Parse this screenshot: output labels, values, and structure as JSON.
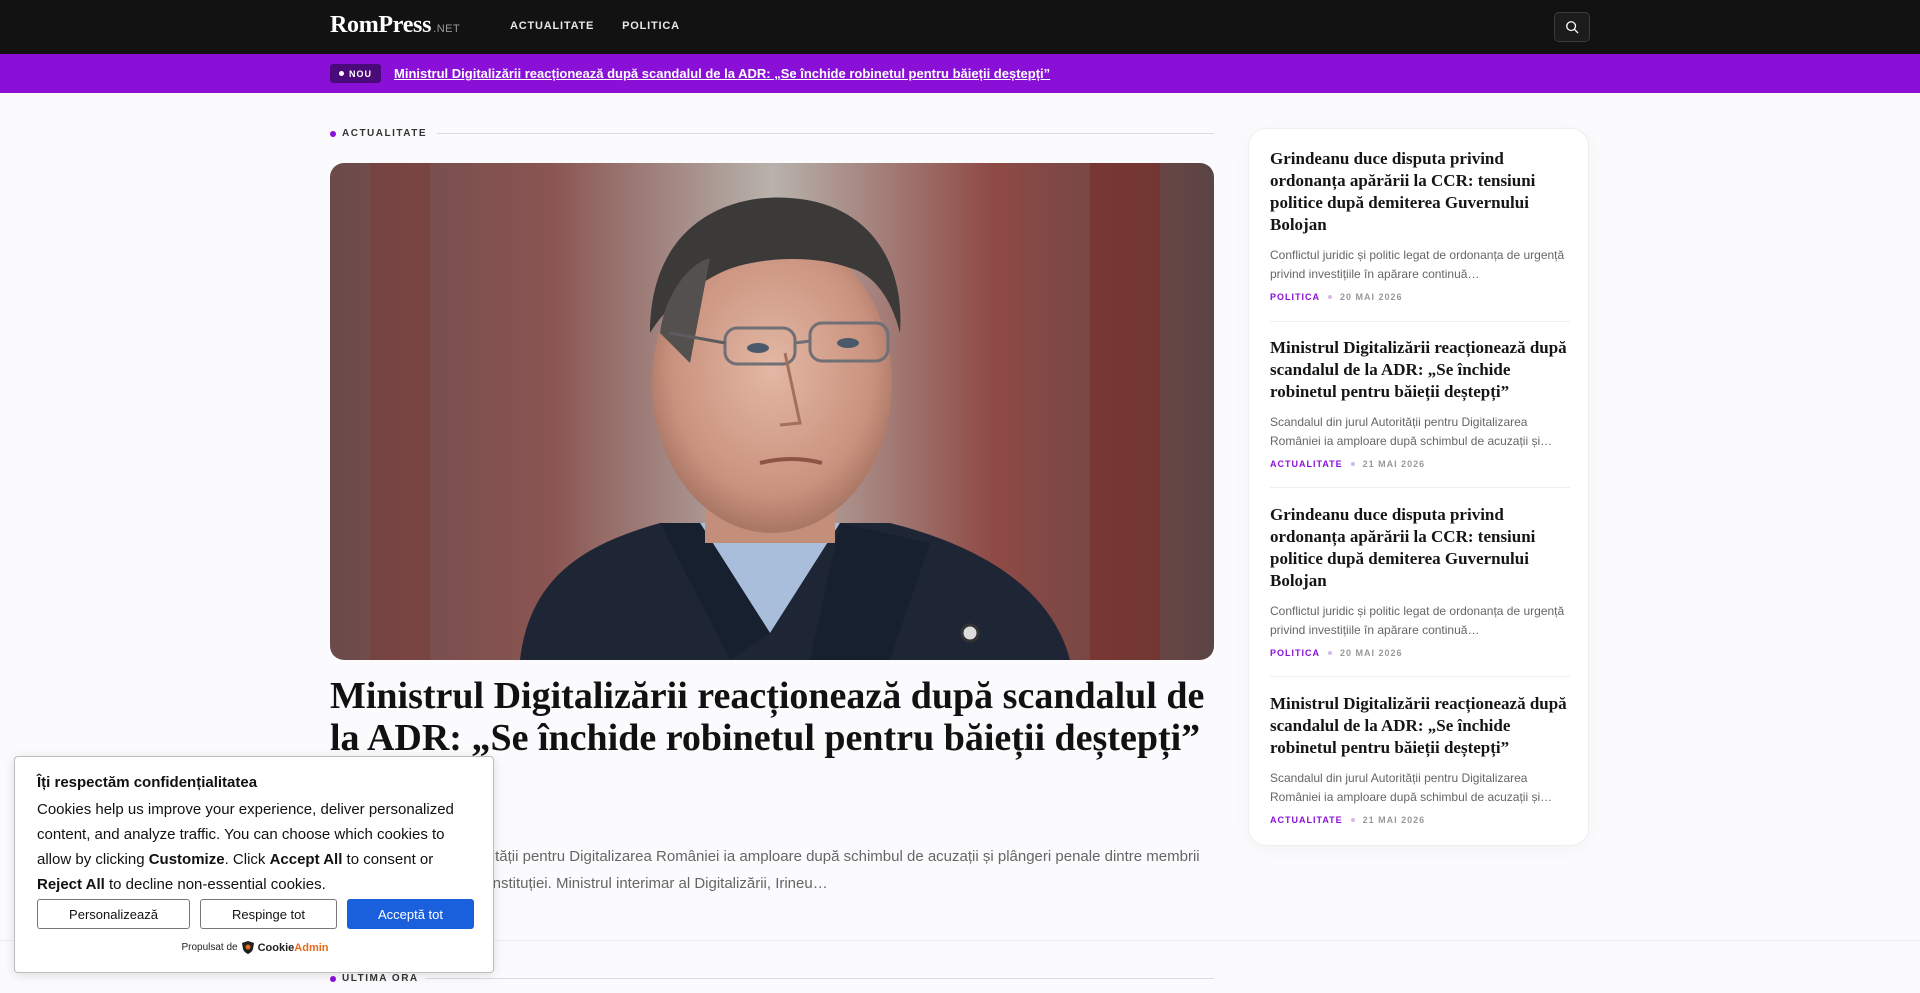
{
  "header": {
    "logo": "RomPress",
    "logo_suffix": ".NET",
    "nav": [
      "ACTUALITATE",
      "POLITICA"
    ],
    "search_icon": "search-icon"
  },
  "ticker": {
    "badge": "NOU",
    "headline": "Ministrul Digitalizării reacționează după scandalul de la ADR: „Se închide robinetul pentru băieții deștepți”"
  },
  "main": {
    "section_label": "ACTUALITATE",
    "hero_title": "Ministrul Digitalizării reacționează după scandalul de la ADR: „Se închide robinetul pentru băieții deștepți”",
    "hero_excerpt": "Scandalul din jurul Autorității pentru Digitalizarea României ia amploare după schimbul de acuzații și plângeri penale dintre membrii echipei de conducere a instituției. Ministrul interimar al Digitalizării, Irineu…"
  },
  "sidebar": {
    "items": [
      {
        "title": "Grindeanu duce disputa privind ordonanța apărării la CCR: tensiuni politice după demiterea Guvernului Bolojan",
        "excerpt": "Conflictul juridic și politic legat de ordonanța de urgență privind investițiile în apărare continuă…",
        "category": "POLITICA",
        "date": "20 MAI 2026"
      },
      {
        "title": "Ministrul Digitalizării reacționează după scandalul de la ADR: „Se închide robinetul pentru băieții deștepți”",
        "excerpt": "Scandalul din jurul Autorității pentru Digitalizarea României ia amploare după schimbul de acuzații și…",
        "category": "ACTUALITATE",
        "date": "21 MAI 2026"
      },
      {
        "title": "Grindeanu duce disputa privind ordonanța apărării la CCR: tensiuni politice după demiterea Guvernului Bolojan",
        "excerpt": "Conflictul juridic și politic legat de ordonanța de urgență privind investițiile în apărare continuă…",
        "category": "POLITICA",
        "date": "20 MAI 2026"
      },
      {
        "title": "Ministrul Digitalizării reacționează după scandalul de la ADR: „Se închide robinetul pentru băieții deștepți”",
        "excerpt": "Scandalul din jurul Autorității pentru Digitalizarea României ia amploare după schimbul de acuzații și…",
        "category": "ACTUALITATE",
        "date": "21 MAI 2026"
      }
    ]
  },
  "bottom": {
    "section_label": "ULTIMA ORA"
  },
  "cookie": {
    "title": "Îți respectăm confidențialitatea",
    "text_1": "Cookies help us improve your experience, deliver personalized content, and analyze traffic. You can choose which cookies to allow by clicking ",
    "customize": "Customize",
    "text_2": ". Click ",
    "accept_all": "Accept All",
    "text_3": " to consent or ",
    "reject_all": "Reject All",
    "text_4": " to decline non-essential cookies.",
    "btn_customize": "Personalizează",
    "btn_reject": "Respinge tot",
    "btn_accept": "Acceptă tot",
    "powered_by": "Propulsat de",
    "brand_1": "Cookie",
    "brand_2": "Admin"
  },
  "colors": {
    "accent": "#8a10d8",
    "header_bg": "#121212",
    "primary_button": "#1a5fdc"
  }
}
